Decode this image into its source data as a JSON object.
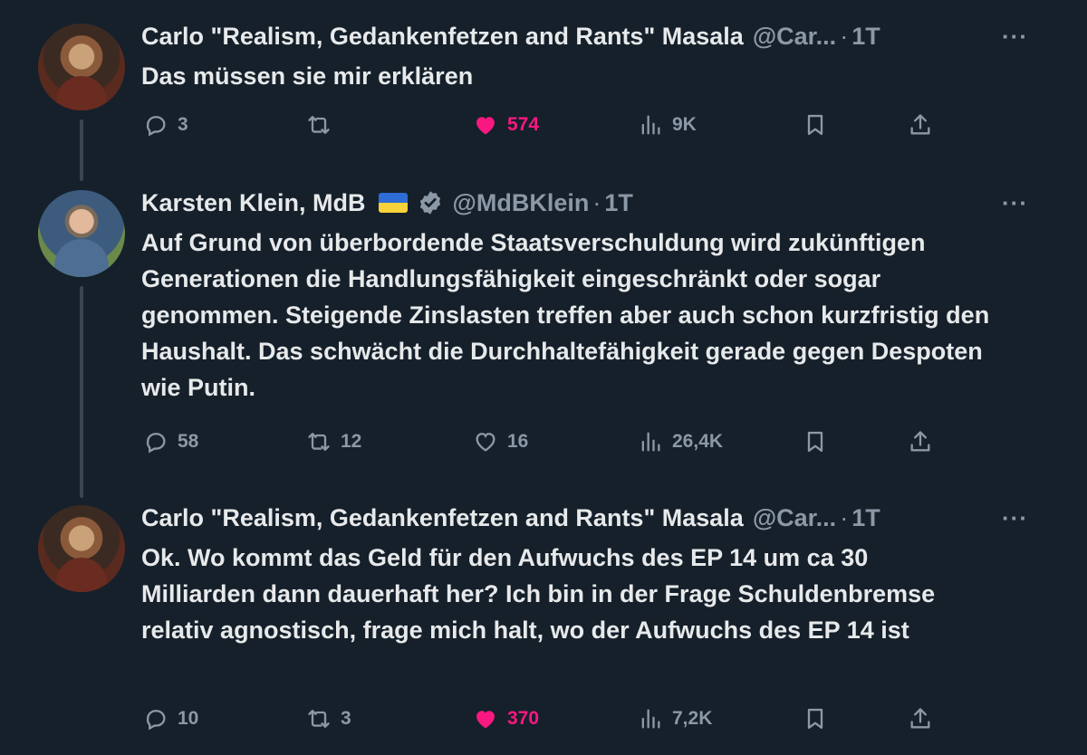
{
  "tweets": [
    {
      "name": "Carlo \"Realism, Gedankenfetzen and Rants\" Masala",
      "handle": "@Car...",
      "time": "1T",
      "text": "Das müssen sie mir erklären",
      "replies": "3",
      "retweets": "",
      "likes": "574",
      "views": "9K",
      "liked": true
    },
    {
      "name": "Karsten Klein, MdB",
      "handle": "@MdBKlein",
      "time": "1T",
      "verified": true,
      "flag": "ukraine-flag",
      "text": "Auf Grund von überbordende Staatsverschuldung wird zukünftigen Generationen die Handlungsfähigkeit eingeschränkt oder sogar genommen. Steigende Zinslasten treffen aber auch schon kurzfristig den Haushalt. Das schwächt die Durchhaltefähigkeit gerade gegen Despoten wie Putin.",
      "replies": "58",
      "retweets": "12",
      "likes": "16",
      "views": "26,4K",
      "liked": false
    },
    {
      "name": "Carlo \"Realism, Gedankenfetzen and Rants\" Masala",
      "handle": "@Car...",
      "time": "1T",
      "text": "Ok. Wo kommt das Geld für den Aufwuchs des EP 14 um ca 30 Milliarden dann dauerhaft her? Ich bin in der Frage Schuldenbremse relativ agnostisch, frage mich halt, wo der Aufwuchs des EP 14 ist",
      "replies": "10",
      "retweets": "3",
      "likes": "370",
      "views": "7,2K",
      "liked": true
    }
  ],
  "dot": "·",
  "more": "···",
  "colors": {
    "background": "#15202b",
    "text": "#e7e9ea",
    "muted": "#8b98a5",
    "like": "#f91880",
    "verified": "#8b98a5"
  }
}
